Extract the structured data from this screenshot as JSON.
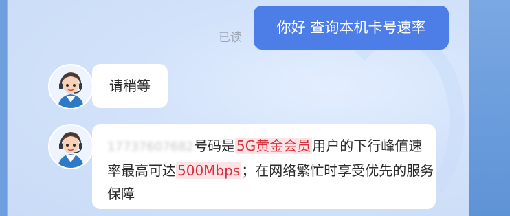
{
  "read_status": "已读",
  "user_message": "你好 查询本机卡号速率",
  "agent_messages": [
    {
      "text": "请稍等"
    },
    {
      "number_masked": "17737607682",
      "part1": "号码是",
      "highlight1": "5G黄金会员",
      "part2": "用户的下行峰值速率最高可达",
      "highlight2": "500Mbps",
      "part3": "；在网络繁忙时享受优先的服务保障"
    }
  ],
  "colors": {
    "user_bubble": "#4d7de6",
    "highlight_text": "#d6303a",
    "highlight_bg": "#fde3e6"
  },
  "icons": {
    "avatar": "customer-service-agent-avatar"
  }
}
